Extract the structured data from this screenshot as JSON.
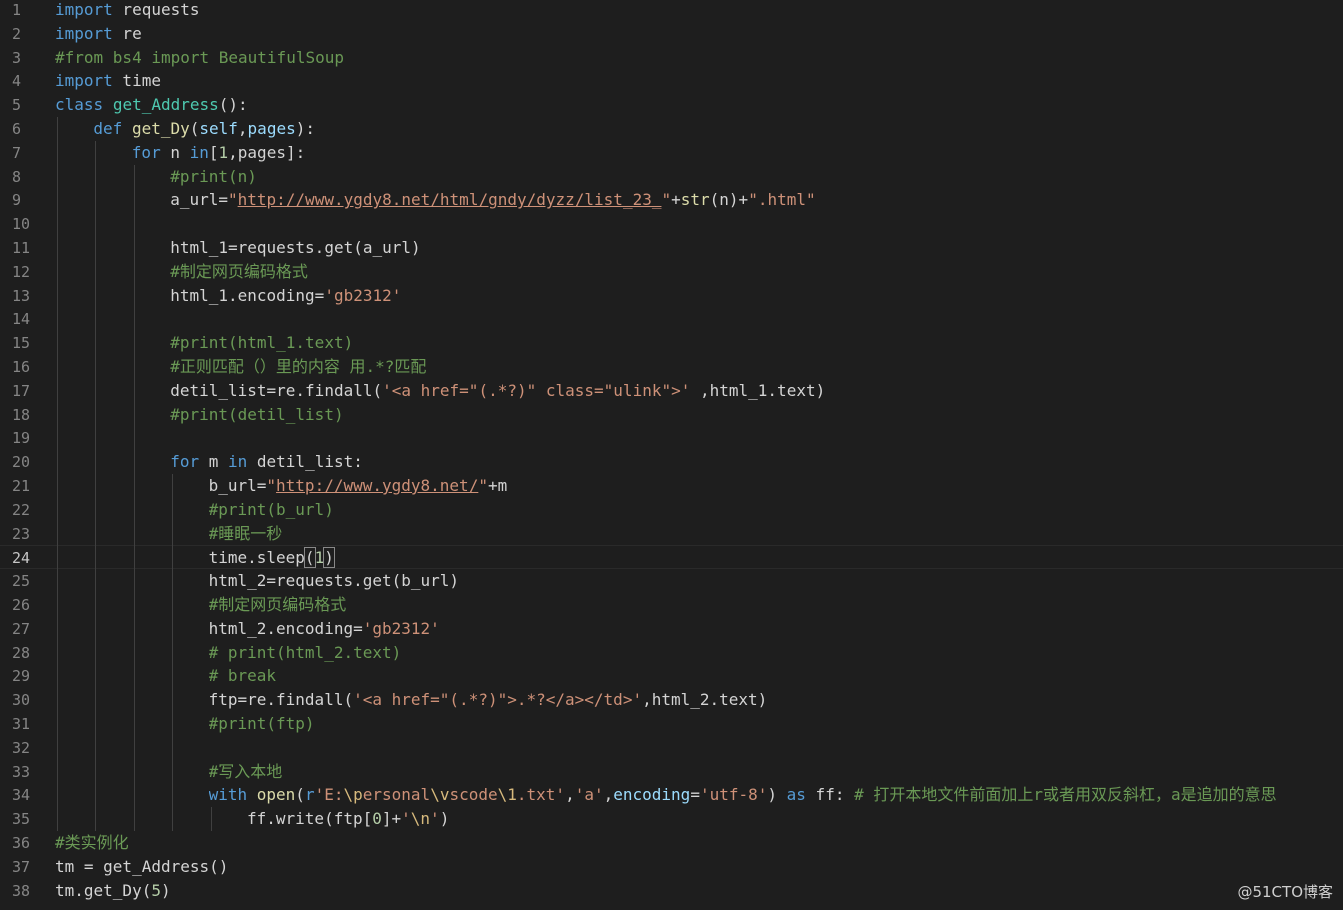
{
  "editor": {
    "current_line": 24,
    "colors": {
      "background": "#1e1e1e",
      "keyword": "#569cd6",
      "control": "#c586c0",
      "function": "#dcdcaa",
      "class": "#4ec9b0",
      "string": "#ce9178",
      "number": "#b5cea8",
      "comment": "#6a9955",
      "variable": "#9cdcfe"
    },
    "lines": [
      {
        "n": "1",
        "indent": 0,
        "tokens": [
          [
            "kw",
            "import"
          ],
          [
            "plain",
            " requests"
          ]
        ]
      },
      {
        "n": "2",
        "indent": 0,
        "tokens": [
          [
            "kw",
            "import"
          ],
          [
            "plain",
            " re"
          ]
        ]
      },
      {
        "n": "3",
        "indent": 0,
        "tokens": [
          [
            "cmt",
            "#from bs4 import BeautifulSoup"
          ]
        ]
      },
      {
        "n": "4",
        "indent": 0,
        "tokens": [
          [
            "kw",
            "import"
          ],
          [
            "plain",
            " time"
          ]
        ]
      },
      {
        "n": "5",
        "indent": 0,
        "tokens": [
          [
            "kw",
            "class"
          ],
          [
            "plain",
            " "
          ],
          [
            "cls",
            "get_Address"
          ],
          [
            "plain",
            "():"
          ]
        ]
      },
      {
        "n": "6",
        "indent": 1,
        "tokens": [
          [
            "kw",
            "def"
          ],
          [
            "plain",
            " "
          ],
          [
            "fn",
            "get_Dy"
          ],
          [
            "plain",
            "("
          ],
          [
            "self",
            "self"
          ],
          [
            "plain",
            ","
          ],
          [
            "var",
            "pages"
          ],
          [
            "plain",
            "):"
          ]
        ]
      },
      {
        "n": "7",
        "indent": 2,
        "tokens": [
          [
            "kw",
            "for"
          ],
          [
            "plain",
            " n "
          ],
          [
            "kw",
            "in"
          ],
          [
            "plain",
            "["
          ],
          [
            "num",
            "1"
          ],
          [
            "plain",
            ",pages]:"
          ]
        ]
      },
      {
        "n": "8",
        "indent": 3,
        "tokens": [
          [
            "cmt",
            "#print(n)"
          ]
        ]
      },
      {
        "n": "9",
        "indent": 3,
        "tokens": [
          [
            "plain",
            "a_url="
          ],
          [
            "str",
            "\""
          ],
          [
            "url",
            "http://www.ygdy8.net/html/gndy/dyzz/list_23_"
          ],
          [
            "str",
            "\""
          ],
          [
            "plain",
            "+"
          ],
          [
            "fn",
            "str"
          ],
          [
            "plain",
            "(n)+"
          ],
          [
            "str",
            "\".html\""
          ]
        ]
      },
      {
        "n": "10",
        "indent": 3,
        "tokens": []
      },
      {
        "n": "11",
        "indent": 3,
        "tokens": [
          [
            "plain",
            "html_1=requests.get(a_url)"
          ]
        ]
      },
      {
        "n": "12",
        "indent": 3,
        "tokens": [
          [
            "cmt",
            "#制定网页编码格式"
          ]
        ]
      },
      {
        "n": "13",
        "indent": 3,
        "tokens": [
          [
            "plain",
            "html_1.encoding="
          ],
          [
            "str",
            "'gb2312'"
          ]
        ]
      },
      {
        "n": "14",
        "indent": 3,
        "tokens": []
      },
      {
        "n": "15",
        "indent": 3,
        "tokens": [
          [
            "cmt",
            "#print(html_1.text)"
          ]
        ]
      },
      {
        "n": "16",
        "indent": 3,
        "tokens": [
          [
            "cmt",
            "#正则匹配（）里的内容 用.*?匹配"
          ]
        ]
      },
      {
        "n": "17",
        "indent": 3,
        "tokens": [
          [
            "plain",
            "detil_list=re.findall("
          ],
          [
            "str",
            "'<a href=\"(.*?)\" class=\"ulink\">'"
          ],
          [
            "plain",
            " ,html_1.text)"
          ]
        ]
      },
      {
        "n": "18",
        "indent": 3,
        "tokens": [
          [
            "cmt",
            "#print(detil_list)"
          ]
        ]
      },
      {
        "n": "19",
        "indent": 3,
        "tokens": []
      },
      {
        "n": "20",
        "indent": 3,
        "tokens": [
          [
            "kw",
            "for"
          ],
          [
            "plain",
            " m "
          ],
          [
            "kw",
            "in"
          ],
          [
            "plain",
            " detil_list:"
          ]
        ]
      },
      {
        "n": "21",
        "indent": 4,
        "tokens": [
          [
            "plain",
            "b_url="
          ],
          [
            "str",
            "\""
          ],
          [
            "url",
            "http://www.ygdy8.net/"
          ],
          [
            "str",
            "\""
          ],
          [
            "plain",
            "+m"
          ]
        ]
      },
      {
        "n": "22",
        "indent": 4,
        "tokens": [
          [
            "cmt",
            "#print(b_url)"
          ]
        ]
      },
      {
        "n": "23",
        "indent": 4,
        "tokens": [
          [
            "cmt",
            "#睡眠一秒"
          ]
        ]
      },
      {
        "n": "24",
        "indent": 4,
        "tokens": [
          [
            "plain",
            "time.sleep"
          ],
          [
            "bracket",
            "("
          ],
          [
            "num",
            "1"
          ],
          [
            "bracket",
            ")"
          ]
        ]
      },
      {
        "n": "25",
        "indent": 4,
        "tokens": [
          [
            "plain",
            "html_2=requests.get(b_url)"
          ]
        ]
      },
      {
        "n": "26",
        "indent": 4,
        "tokens": [
          [
            "cmt",
            "#制定网页编码格式"
          ]
        ]
      },
      {
        "n": "27",
        "indent": 4,
        "tokens": [
          [
            "plain",
            "html_2.encoding="
          ],
          [
            "str",
            "'gb2312'"
          ]
        ]
      },
      {
        "n": "28",
        "indent": 4,
        "tokens": [
          [
            "cmt",
            "# print(html_2.text)"
          ]
        ]
      },
      {
        "n": "29",
        "indent": 4,
        "tokens": [
          [
            "cmt",
            "# break"
          ]
        ]
      },
      {
        "n": "30",
        "indent": 4,
        "tokens": [
          [
            "plain",
            "ftp=re.findall("
          ],
          [
            "str",
            "'<a href=\"(.*?)\">.*?</a></td>'"
          ],
          [
            "plain",
            ",html_2.text)"
          ]
        ]
      },
      {
        "n": "31",
        "indent": 4,
        "tokens": [
          [
            "cmt",
            "#print(ftp)"
          ]
        ]
      },
      {
        "n": "32",
        "indent": 4,
        "tokens": []
      },
      {
        "n": "33",
        "indent": 4,
        "tokens": [
          [
            "cmt",
            "#写入本地"
          ]
        ]
      },
      {
        "n": "34",
        "indent": 4,
        "tokens": [
          [
            "kw",
            "with"
          ],
          [
            "plain",
            " "
          ],
          [
            "fn",
            "open"
          ],
          [
            "plain",
            "("
          ],
          [
            "kw",
            "r"
          ],
          [
            "str",
            "'E:"
          ],
          [
            "esc",
            "\\p"
          ],
          [
            "str",
            "ersonal"
          ],
          [
            "esc",
            "\\v"
          ],
          [
            "str",
            "scode"
          ],
          [
            "esc",
            "\\1"
          ],
          [
            "str",
            ".txt'"
          ],
          [
            "plain",
            ","
          ],
          [
            "str",
            "'a'"
          ],
          [
            "plain",
            ","
          ],
          [
            "var",
            "encoding"
          ],
          [
            "plain",
            "="
          ],
          [
            "str",
            "'utf-8'"
          ],
          [
            "plain",
            ") "
          ],
          [
            "kw",
            "as"
          ],
          [
            "plain",
            " ff: "
          ],
          [
            "cmt",
            "# 打开本地文件前面加上r或者用双反斜杠，a是追加的意思"
          ]
        ]
      },
      {
        "n": "35",
        "indent": 5,
        "tokens": [
          [
            "plain",
            "ff.write(ftp["
          ],
          [
            "num",
            "0"
          ],
          [
            "plain",
            "]+"
          ],
          [
            "str",
            "'"
          ],
          [
            "esc",
            "\\n"
          ],
          [
            "str",
            "'"
          ],
          [
            "plain",
            ")"
          ]
        ]
      },
      {
        "n": "36",
        "indent": 0,
        "tokens": [
          [
            "cmt",
            "#类实例化"
          ]
        ]
      },
      {
        "n": "37",
        "indent": 0,
        "tokens": [
          [
            "plain",
            "tm = get_Address()"
          ]
        ]
      },
      {
        "n": "38",
        "indent": 0,
        "tokens": [
          [
            "plain",
            "tm.get_Dy("
          ],
          [
            "num",
            "5"
          ],
          [
            "plain",
            ")"
          ]
        ]
      }
    ]
  },
  "watermark": "@51CTO博客"
}
